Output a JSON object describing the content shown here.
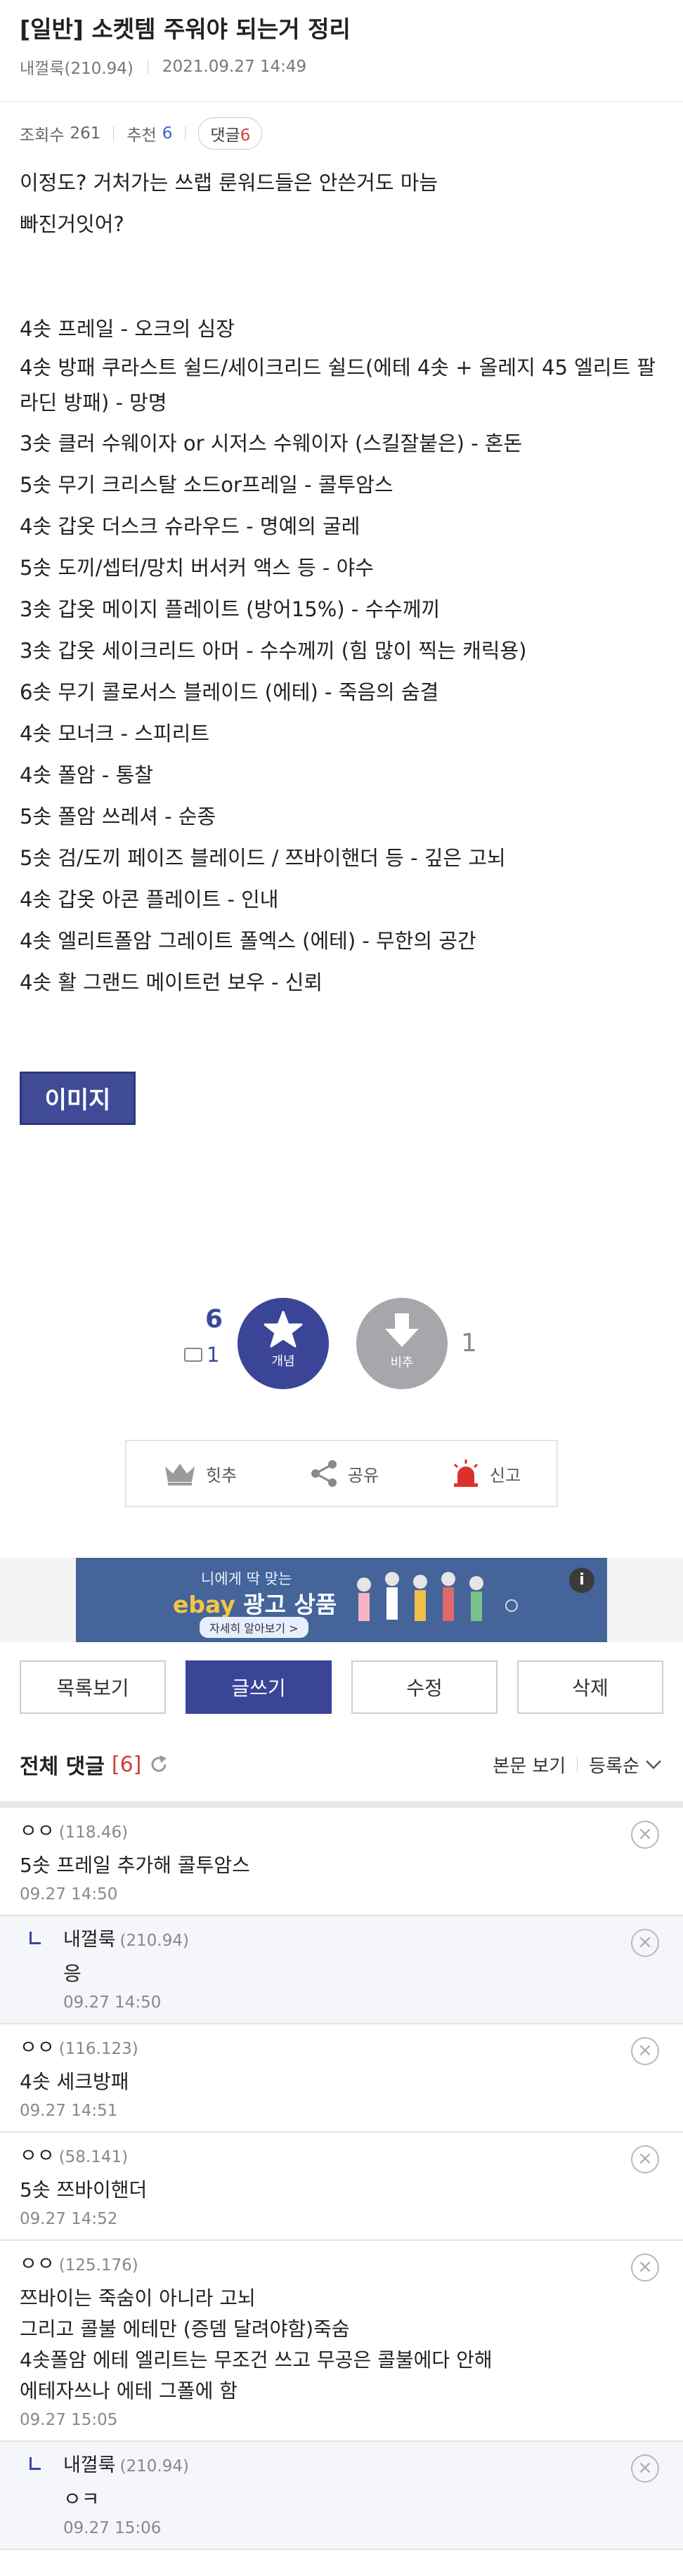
{
  "post": {
    "title": "[일반] 소켓템 주워야 되는거 정리",
    "author": "내껄룩(210.94)",
    "date": "2021.09.27 14:49",
    "views_label": "조회수",
    "views": "261",
    "recommend_label": "추천",
    "recommend": "6",
    "comments_label": "댓글",
    "comments": "6",
    "image_label": "이미지",
    "lines": [
      "이정도? 거처가는 쓰랩 룬워드들은 안쓴거도 마늠",
      "빠진거잇어?",
      "",
      "4솟 프레일 - 오크의 심장",
      "4솟 방패 쿠라스트 쉴드/세이크리드 쉴드(에테 4솟 + 올레지 45 엘리트 팔라딘 방패) - 망명",
      "3솟 클러 수웨이자 or 시저스 수웨이자 (스킬잘붙은) - 혼돈",
      "5솟 무기 크리스탈 소드or프레일 - 콜투암스",
      "4솟 갑옷 더스크 슈라우드 - 명예의 굴레",
      "5솟 도끼/셉터/망치 버서커 액스 등 - 야수",
      "3솟 갑옷 메이지 플레이트 (방어15%) - 수수께끼",
      "3솟 갑옷 세이크리드 아머 - 수수께끼 (힘 많이 찍는 캐릭용)",
      "6솟 무기 콜로서스 블레이드 (에테) - 죽음의 숨결",
      "4솟 모너크 - 스피리트",
      "4솟 폴암 - 통찰",
      "5솟 폴암 쓰레셔 - 순종",
      "5솟 검/도끼 페이즈 블레이드 / 쯔바이핸더 등 - 깊은 고뇌",
      "4솟 갑옷 아콘 플레이트 - 인내",
      "4솟 엘리트폴암 그레이트 폴엑스 (에테) - 무한의 공간",
      "4솟 활 그랜드 메이트런 보우 - 신뢰"
    ]
  },
  "votes": {
    "up_count": "6",
    "up_fixed": "1",
    "up_label": "개념",
    "down_label": "비추",
    "down_count": "1"
  },
  "actions": {
    "hit": "힛추",
    "share": "공유",
    "report": "신고"
  },
  "ad": {
    "sub": "니에게 딱 맞는",
    "brand": "ebay",
    "brand_rest": "광고 상품",
    "cta": "자세히 알아보기 >",
    "info": "i"
  },
  "buttons": {
    "list": "목록보기",
    "write": "글쓰기",
    "edit": "수정",
    "delete": "삭제"
  },
  "comments_header": {
    "title": "전체 댓글",
    "count": "[6]",
    "view_body": "본문 보기",
    "sort": "등록순"
  },
  "comment_list": [
    {
      "author": "ㅇㅇ",
      "ip": "(118.46)",
      "text": "5솟 프레일 추가해 콜투암스",
      "time": "09.27 14:50",
      "reply": false
    },
    {
      "author": "내껄룩",
      "ip": "(210.94)",
      "text": "응",
      "time": "09.27 14:50",
      "reply": true
    },
    {
      "author": "ㅇㅇ",
      "ip": "(116.123)",
      "text": "4솟 세크방패",
      "time": "09.27 14:51",
      "reply": false
    },
    {
      "author": "ㅇㅇ",
      "ip": "(58.141)",
      "text": "5솟 쯔바이핸더",
      "time": "09.27 14:52",
      "reply": false
    },
    {
      "author": "ㅇㅇ",
      "ip": "(125.176)",
      "text": "쯔바이는 죽숨이 아니라 고뇌\n그리고 콜불 에테만 (증뎀 달려야함)죽숨\n4솟폴암 에테 엘리트는 무조건 쓰고 무공은 콜불에다 안해\n에테자쓰나 에테 그폴에 함",
      "time": "09.27 15:05",
      "reply": false
    },
    {
      "author": "내껄룩",
      "ip": "(210.94)",
      "text": "ㅇㅋ",
      "time": "09.27 15:06",
      "reply": true
    }
  ],
  "colors": {
    "accent": "#3a4597",
    "count_red": "#c9423a",
    "recommend_blue": "#3b63c6"
  }
}
